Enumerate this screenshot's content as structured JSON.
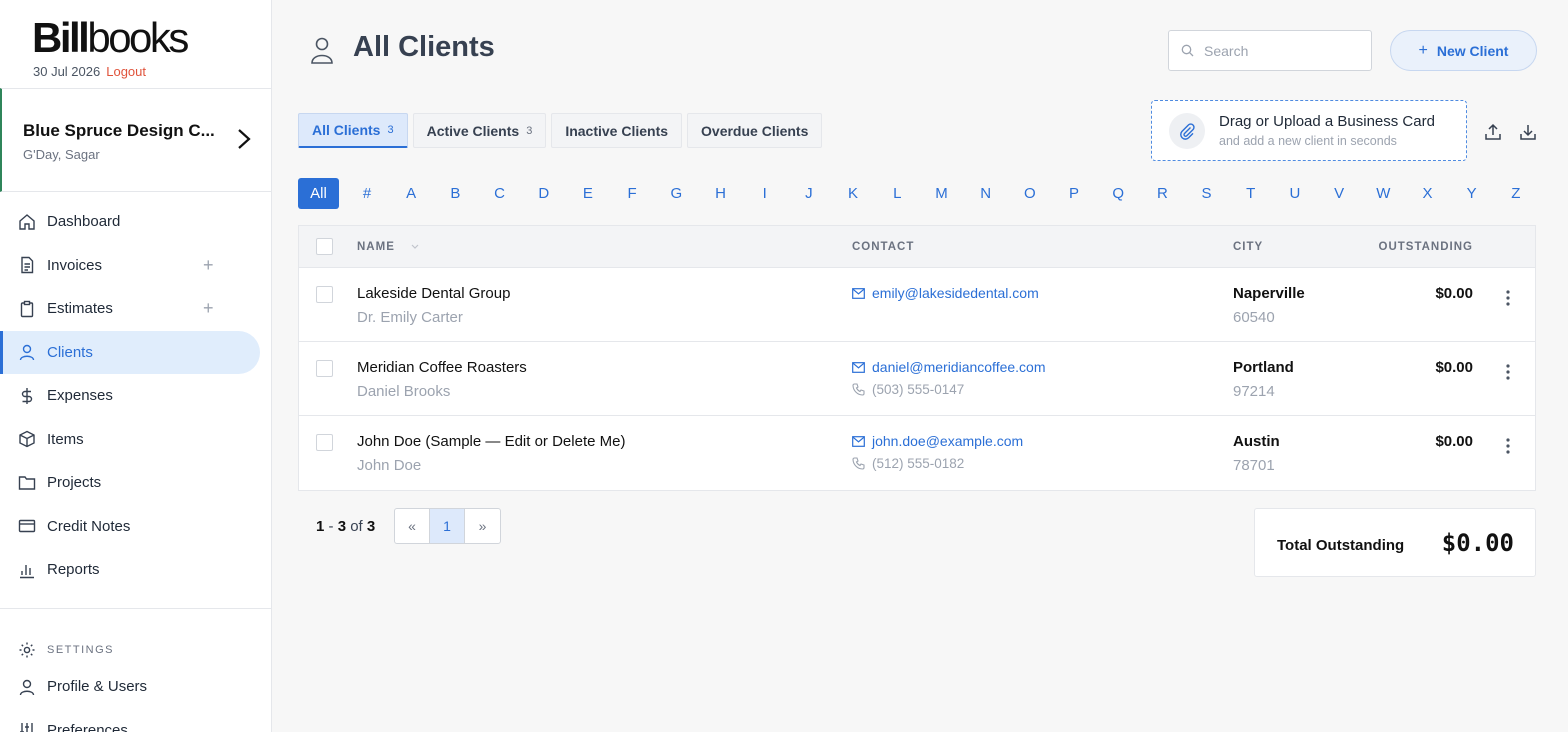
{
  "brand": {
    "logo_bold": "Bill",
    "logo_rest": "books",
    "date": "30 Jul 2026",
    "logout": "Logout"
  },
  "org": {
    "name": "Blue Spruce Design C...",
    "greeting": "G'Day, Sagar"
  },
  "nav": {
    "items": [
      {
        "label": "Dashboard",
        "icon": "home-icon"
      },
      {
        "label": "Invoices",
        "icon": "document-icon",
        "add": "+"
      },
      {
        "label": "Estimates",
        "icon": "clipboard-icon",
        "add": "+"
      },
      {
        "label": "Clients",
        "icon": "user-icon"
      },
      {
        "label": "Expenses",
        "icon": "dollar-icon"
      },
      {
        "label": "Items",
        "icon": "box-icon"
      },
      {
        "label": "Projects",
        "icon": "folder-icon"
      },
      {
        "label": "Credit Notes",
        "icon": "card-icon"
      },
      {
        "label": "Reports",
        "icon": "bar-chart-icon"
      }
    ],
    "settings_label": "SETTINGS",
    "settings_items": [
      {
        "label": "Profile & Users",
        "icon": "user-icon"
      },
      {
        "label": "Preferences",
        "icon": "sliders-icon"
      }
    ]
  },
  "header": {
    "title": "All Clients",
    "search_placeholder": "Search",
    "new_client": "New Client",
    "new_client_plus": "+"
  },
  "tabs": [
    {
      "label": "All Clients",
      "count": "3"
    },
    {
      "label": "Active Clients",
      "count": "3"
    },
    {
      "label": "Inactive Clients",
      "count": ""
    },
    {
      "label": "Overdue Clients",
      "count": ""
    }
  ],
  "upload": {
    "title": "Drag or Upload a Business Card",
    "subtitle": "and add a new client in seconds"
  },
  "alphabet": [
    "All",
    "#",
    "A",
    "B",
    "C",
    "D",
    "E",
    "F",
    "G",
    "H",
    "I",
    "J",
    "K",
    "L",
    "M",
    "N",
    "O",
    "P",
    "Q",
    "R",
    "S",
    "T",
    "U",
    "V",
    "W",
    "X",
    "Y",
    "Z"
  ],
  "table": {
    "headers": {
      "name": "NAME",
      "contact": "CONTACT",
      "city": "CITY",
      "outstanding": "OUTSTANDING"
    },
    "rows": [
      {
        "name": "Lakeside Dental Group",
        "contact_person": "Dr. Emily Carter",
        "email": "emily@lakesidedental.com",
        "phone": "",
        "city": "Naperville",
        "zip": "60540",
        "outstanding": "$0.00"
      },
      {
        "name": "Meridian Coffee Roasters",
        "contact_person": "Daniel Brooks",
        "email": "daniel@meridiancoffee.com",
        "phone": "(503) 555-0147",
        "city": "Portland",
        "zip": "97214",
        "outstanding": "$0.00"
      },
      {
        "name": "John Doe (Sample — Edit or Delete Me)",
        "contact_person": "John Doe",
        "email": "john.doe@example.com",
        "phone": "(512) 555-0182",
        "city": "Austin",
        "zip": "78701",
        "outstanding": "$0.00"
      }
    ]
  },
  "pagination": {
    "from": "1",
    "sep": " - ",
    "to": "3",
    "of": " of ",
    "total": "3",
    "prev": "«",
    "current": "1",
    "next": "»"
  },
  "totals": {
    "label": "Total Outstanding",
    "value": "$0.00"
  },
  "colors": {
    "accent": "#2b6fd6",
    "active_bg": "#e0edfc",
    "logout": "#e0533b"
  }
}
